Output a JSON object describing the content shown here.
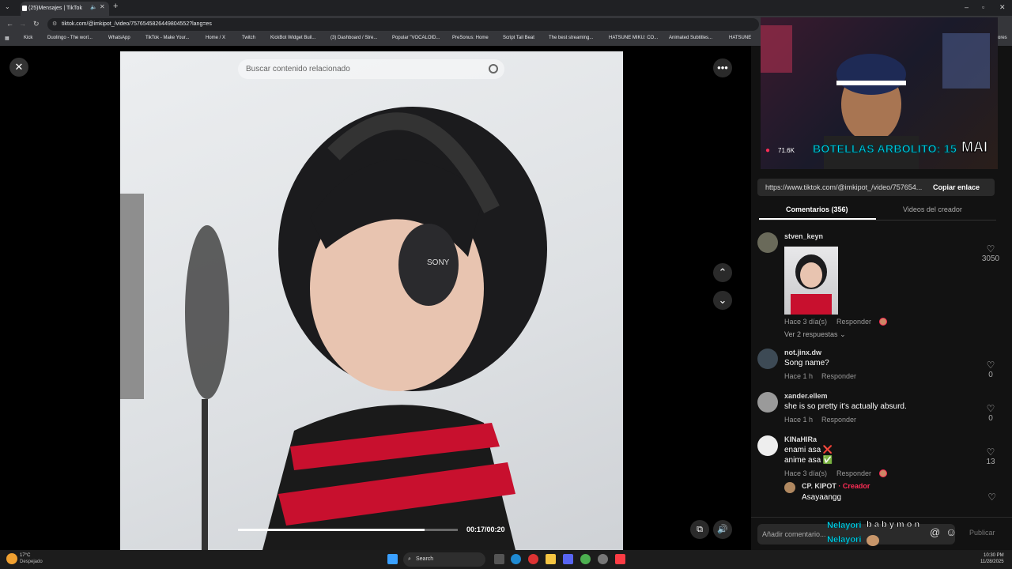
{
  "browser": {
    "tab_title": "(25)Mensajes | TikTok",
    "url": "tiktok.com/@imkipot_/video/7576545826449804552?lang=es",
    "bookmarks": [
      "Kick",
      "Duolingo - The worl...",
      "WhatsApp",
      "TikTok - Make Your...",
      "Home / X",
      "Twitch",
      "KickBot Widget Buil...",
      "(3) Dashboard / Stre...",
      "Popular \"VOCALOID...",
      "PreSonus: Home",
      "Script Tail Beat",
      "The best streaming...",
      "HATSUNE MIKU: CO...",
      "Animated Subtitles...",
      "HATSUNE"
    ],
    "bookmarks_more": "ores"
  },
  "video": {
    "search_placeholder": "Buscar contenido relacionado",
    "time": "00:17/00:20",
    "progress": 0.85
  },
  "stream_overlay": {
    "banner": "BOTELLAS ARBOLITO: 15",
    "mai": "MAI",
    "likes_count": "71.6K"
  },
  "share": {
    "link": "https://www.tiktok.com/@imkipot_/video/757654...",
    "copy_label": "Copiar enlace"
  },
  "tabs": {
    "comments": "Comentarios (356)",
    "creator_videos": "Videos del creador"
  },
  "comments": [
    {
      "user": "stven_keyn",
      "text": "",
      "time": "Hace 3 día(s)",
      "reply": "Responder",
      "likes": "3050",
      "more": "Ver 2 respuestas"
    },
    {
      "user": "not.jinx.dw",
      "text": "Song name?",
      "time": "Hace 1 h",
      "reply": "Responder",
      "likes": "0"
    },
    {
      "user": "xander.ellem",
      "text": "she is so pretty it's actually absurd.",
      "time": "Hace 1 h",
      "reply": "Responder",
      "likes": "0"
    },
    {
      "user": "KINaHIRa",
      "text": "enami asa ❌",
      "text2": "anime asa ✅",
      "time": "Hace 3 día(s)",
      "reply": "Responder",
      "likes": "13"
    },
    {
      "user": "CP. KIPOT",
      "creator_tag": "· Creador",
      "text": "Asayaangg"
    }
  ],
  "comment_bar": {
    "placeholder": "Añadir comentario...",
    "publish": "Publicar"
  },
  "chat_overlay": {
    "user1": "Nelayori",
    "msg1": "b a b y m o n",
    "user2": "Nelayori"
  },
  "taskbar": {
    "weather_temp": "17°C",
    "weather_desc": "Despejado",
    "search": "Search",
    "time": "10:30 PM",
    "date": "11/28/2025"
  },
  "colors": {
    "accent_red": "#fe2c55",
    "cyan_overlay": "#00e5ff"
  }
}
